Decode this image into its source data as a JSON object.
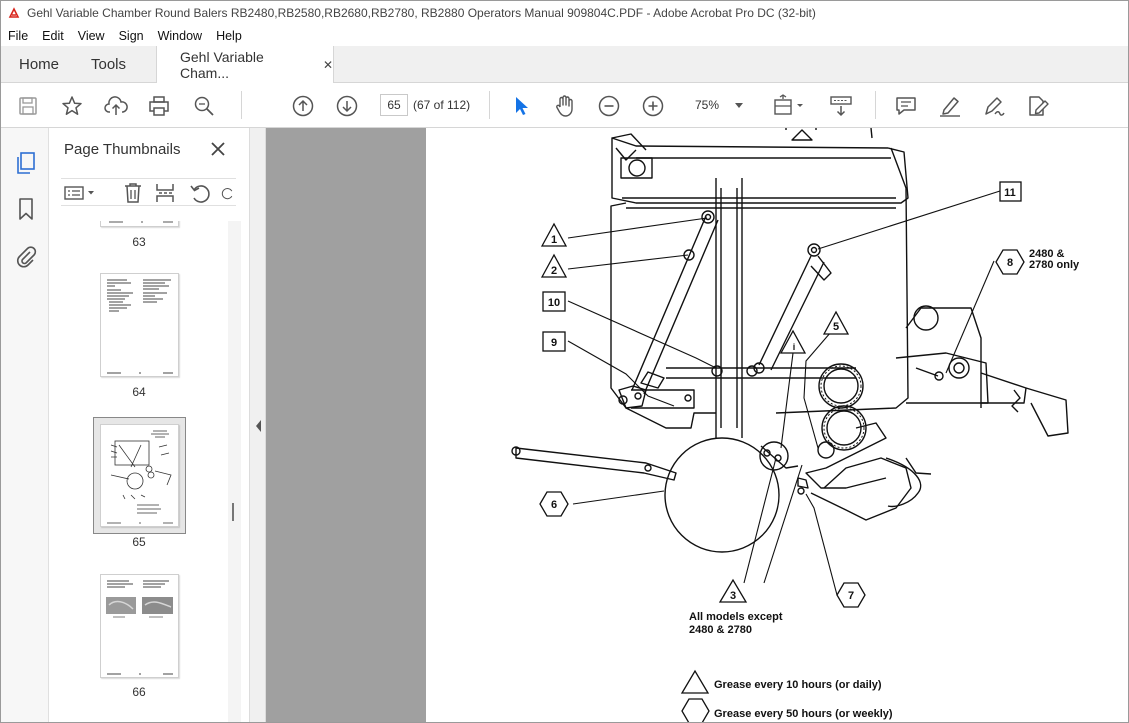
{
  "window": {
    "title": "Gehl Variable Chamber Round Balers RB2480,RB2580,RB2680,RB2780, RB2880 Operators Manual 909804C.PDF - Adobe Acrobat Pro DC (32-bit)"
  },
  "menu": [
    "File",
    "Edit",
    "View",
    "Sign",
    "Window",
    "Help"
  ],
  "tabs": {
    "home": "Home",
    "tools": "Tools",
    "document": "Gehl Variable Cham...",
    "close_glyph": "✕"
  },
  "toolbar": {
    "page_number": "65",
    "page_count": "(67 of 112)",
    "zoom": "75%"
  },
  "thumbnails": {
    "title": "Page Thumbnails",
    "close_glyph": "✕",
    "pages": [
      "63",
      "64",
      "65",
      "66"
    ],
    "selected": "65"
  },
  "diagram": {
    "callouts": [
      "1",
      "2",
      "10",
      "9",
      "11",
      "8",
      "5",
      "6",
      "3",
      "7"
    ],
    "note_2480_line1": "2480 &",
    "note_2480_line2": "2780 only",
    "note_all_line1": "All models except",
    "note_all_line2": "2480 & 2780",
    "legend_triangle": "Grease every 10 hours (or daily)",
    "legend_hexagon": "Grease every 50 hours (or weekly)"
  },
  "colors": {
    "accent_blue": "#2d6fd2",
    "selection_blue": "#1473e6",
    "acrobat_red": "#d9251c",
    "gray_canvas": "#a0a0a0"
  }
}
